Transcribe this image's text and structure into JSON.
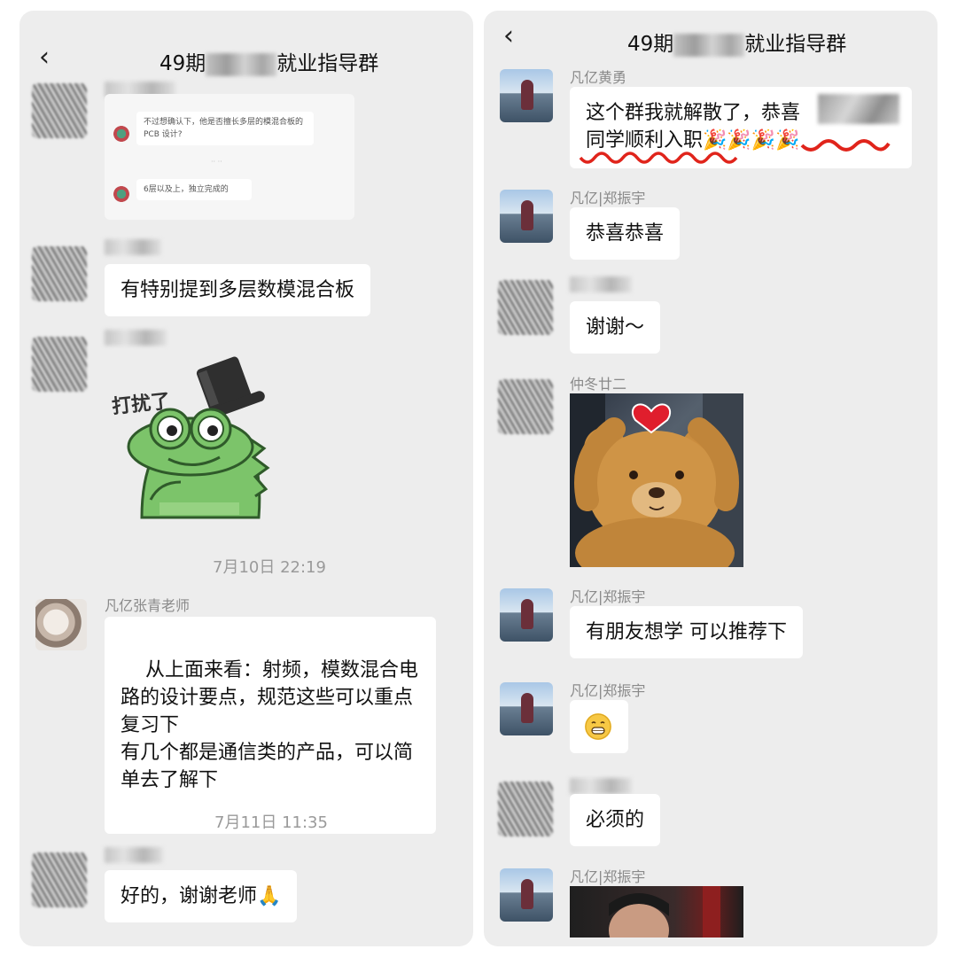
{
  "left": {
    "title_prefix": "49期",
    "title_suffix": "就业指导群",
    "quoted": {
      "msg1": "不过想确认下，他是否擅长多层的模混合板的 PCB 设计?",
      "msg2": "6层以及上，独立完成的"
    },
    "msg_mixed_board": "有特别提到多层数模混合板",
    "sticker_text": "打扰了",
    "time1": "7月10日 22:19",
    "teacher_name": "凡亿张青老师",
    "teacher_msg": "从上面来看：射频，模数混合电路的设计要点，规范这些可以重点复习下\n有几个都是通信类的产品，可以简单去了解下",
    "time2": "7月11日 11:35",
    "thanks_msg": "好的，谢谢老师🙏"
  },
  "right": {
    "title_prefix": "49期",
    "title_suffix": "就业指导群",
    "sender1": "凡亿黄勇",
    "msg1_line1": "这个群我就解散了，恭喜",
    "msg1_line2": "同学顺利入职🎉🎉🎉🎉",
    "sender2": "凡亿|郑振宇",
    "msg2": "恭喜恭喜",
    "msg3": "谢谢～",
    "sender4": "仲冬廿二",
    "sender5": "凡亿|郑振宇",
    "msg5": "有朋友想学 可以推荐下",
    "sender6": "凡亿|郑振宇",
    "msg7": "必须的",
    "sender8": "凡亿|郑振宇"
  },
  "colors": {
    "panel_bg": "#ededed",
    "bubble_bg": "#ffffff",
    "meta_text": "#8a8a8a",
    "underline_red": "#e0241b",
    "sticker_green": "#7cc46a"
  }
}
